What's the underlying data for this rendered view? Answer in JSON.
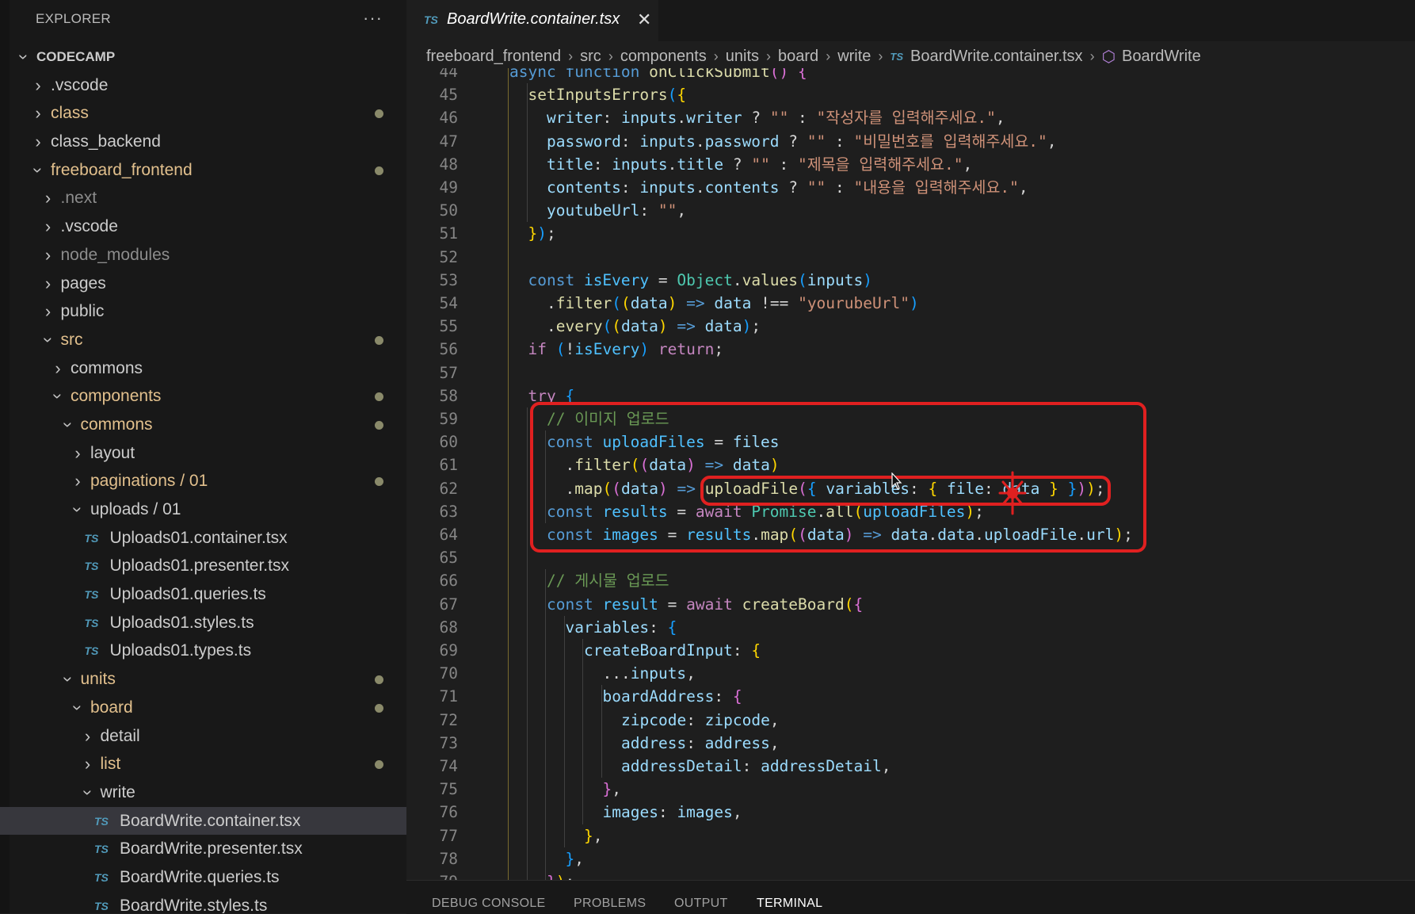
{
  "explorer": {
    "header": "EXPLORER",
    "more": "···",
    "tree": [
      {
        "depth": 0,
        "kind": "folder",
        "open": true,
        "name": "CODECAMP",
        "root": true,
        "color": "#cccccc"
      },
      {
        "depth": 1,
        "kind": "folder",
        "open": false,
        "name": ".vscode",
        "color": "#cccccc"
      },
      {
        "depth": 1,
        "kind": "folder",
        "open": false,
        "name": "class",
        "color": "#e2c08d",
        "modified": true
      },
      {
        "depth": 1,
        "kind": "folder",
        "open": false,
        "name": "class_backend",
        "color": "#cccccc"
      },
      {
        "depth": 1,
        "kind": "folder",
        "open": true,
        "name": "freeboard_frontend",
        "color": "#e2c08d",
        "modified": true
      },
      {
        "depth": 2,
        "kind": "folder",
        "open": false,
        "name": ".next",
        "color": "#8c8c8c"
      },
      {
        "depth": 2,
        "kind": "folder",
        "open": false,
        "name": ".vscode",
        "color": "#cccccc"
      },
      {
        "depth": 2,
        "kind": "folder",
        "open": false,
        "name": "node_modules",
        "color": "#8c8c8c"
      },
      {
        "depth": 2,
        "kind": "folder",
        "open": false,
        "name": "pages",
        "color": "#cccccc"
      },
      {
        "depth": 2,
        "kind": "folder",
        "open": false,
        "name": "public",
        "color": "#cccccc"
      },
      {
        "depth": 2,
        "kind": "folder",
        "open": true,
        "name": "src",
        "color": "#e2c08d",
        "modified": true
      },
      {
        "depth": 3,
        "kind": "folder",
        "open": false,
        "name": "commons",
        "color": "#cccccc"
      },
      {
        "depth": 3,
        "kind": "folder",
        "open": true,
        "name": "components",
        "color": "#e2c08d",
        "modified": true
      },
      {
        "depth": 4,
        "kind": "folder",
        "open": true,
        "name": "commons",
        "color": "#e2c08d",
        "modified": true
      },
      {
        "depth": 5,
        "kind": "folder",
        "open": false,
        "name": "layout",
        "color": "#cccccc"
      },
      {
        "depth": 5,
        "kind": "folder",
        "open": false,
        "name": "paginations / 01",
        "color": "#e2c08d",
        "modified": true
      },
      {
        "depth": 5,
        "kind": "folder",
        "open": true,
        "name": "uploads / 01",
        "color": "#cccccc"
      },
      {
        "depth": 6,
        "kind": "file",
        "name": "Uploads01.container.tsx",
        "color": "#cccccc"
      },
      {
        "depth": 6,
        "kind": "file",
        "name": "Uploads01.presenter.tsx",
        "color": "#cccccc"
      },
      {
        "depth": 6,
        "kind": "file",
        "name": "Uploads01.queries.ts",
        "color": "#cccccc"
      },
      {
        "depth": 6,
        "kind": "file",
        "name": "Uploads01.styles.ts",
        "color": "#cccccc"
      },
      {
        "depth": 6,
        "kind": "file",
        "name": "Uploads01.types.ts",
        "color": "#cccccc"
      },
      {
        "depth": 4,
        "kind": "folder",
        "open": true,
        "name": "units",
        "color": "#e2c08d",
        "modified": true
      },
      {
        "depth": 5,
        "kind": "folder",
        "open": true,
        "name": "board",
        "color": "#e2c08d",
        "modified": true
      },
      {
        "depth": 6,
        "kind": "folder",
        "open": false,
        "name": "detail",
        "color": "#cccccc"
      },
      {
        "depth": 6,
        "kind": "folder",
        "open": false,
        "name": "list",
        "color": "#e2c08d",
        "modified": true
      },
      {
        "depth": 6,
        "kind": "folder",
        "open": true,
        "name": "write",
        "color": "#cccccc"
      },
      {
        "depth": 7,
        "kind": "file",
        "name": "BoardWrite.container.tsx",
        "color": "#cccccc",
        "selected": true
      },
      {
        "depth": 7,
        "kind": "file",
        "name": "BoardWrite.presenter.tsx",
        "color": "#cccccc"
      },
      {
        "depth": 7,
        "kind": "file",
        "name": "BoardWrite.queries.ts",
        "color": "#cccccc"
      },
      {
        "depth": 7,
        "kind": "file",
        "name": "BoardWrite.styles.ts",
        "color": "#cccccc"
      }
    ]
  },
  "tab": {
    "icon": "TS",
    "title": "BoardWrite.container.tsx",
    "close": "✕"
  },
  "breadcrumb": {
    "parts": [
      "freeboard_frontend",
      "src",
      "components",
      "units",
      "board",
      "write"
    ],
    "file_icon": "TS",
    "file": "BoardWrite.container.tsx",
    "symbol_icon": "⬡",
    "symbol": "BoardWrite"
  },
  "editor": {
    "lines": [
      {
        "n": "44",
        "indent": 1,
        "html": "<span class=\"kw\">async</span> <span class=\"kw\">function</span> <span class=\"fn\">onClickSubmit</span><span class=\"p2\">()</span> <span class=\"p2\">{</span>"
      },
      {
        "n": "45",
        "indent": 2,
        "html": "<span class=\"fn\">setInputsErrors</span><span class=\"p3\">(</span><span class=\"p1\">{</span>"
      },
      {
        "n": "46",
        "indent": 3,
        "html": "<span class=\"prop\">writer</span>: <span class=\"prop\">inputs</span>.<span class=\"prop\">writer</span> ? <span class=\"str\">\"\"</span> : <span class=\"str\">\"작성자를 입력해주세요.\"</span>,"
      },
      {
        "n": "47",
        "indent": 3,
        "html": "<span class=\"prop\">password</span>: <span class=\"prop\">inputs</span>.<span class=\"prop\">password</span> ? <span class=\"str\">\"\"</span> : <span class=\"str\">\"비밀번호를 입력해주세요.\"</span>,"
      },
      {
        "n": "48",
        "indent": 3,
        "html": "<span class=\"prop\">title</span>: <span class=\"prop\">inputs</span>.<span class=\"prop\">title</span> ? <span class=\"str\">\"\"</span> : <span class=\"str\">\"제목을 입력해주세요.\"</span>,"
      },
      {
        "n": "49",
        "indent": 3,
        "html": "<span class=\"prop\">contents</span>: <span class=\"prop\">inputs</span>.<span class=\"prop\">contents</span> ? <span class=\"str\">\"\"</span> : <span class=\"str\">\"내용을 입력해주세요.\"</span>,"
      },
      {
        "n": "50",
        "indent": 3,
        "html": "<span class=\"prop\">youtubeUrl</span>: <span class=\"str\">\"\"</span>,"
      },
      {
        "n": "51",
        "indent": 2,
        "html": "<span class=\"p1\">}</span><span class=\"p3\">)</span>;"
      },
      {
        "n": "52",
        "indent": 0,
        "html": ""
      },
      {
        "n": "53",
        "indent": 2,
        "html": "<span class=\"kw\">const</span> <span class=\"cn\">isEvery</span> = <span class=\"cls\">Object</span>.<span class=\"fn\">values</span><span class=\"p3\">(</span><span class=\"prop\">inputs</span><span class=\"p3\">)</span>"
      },
      {
        "n": "54",
        "indent": 3,
        "html": ".<span class=\"fn\">filter</span><span class=\"p3\">(</span><span class=\"p1\">(</span><span class=\"prop\">data</span><span class=\"p1\">)</span> <span class=\"kw\">=&gt;</span> <span class=\"prop\">data</span> !== <span class=\"str\">\"yourubeUrl\"</span><span class=\"p3\">)</span>"
      },
      {
        "n": "55",
        "indent": 3,
        "html": ".<span class=\"fn\">every</span><span class=\"p3\">(</span><span class=\"p1\">(</span><span class=\"prop\">data</span><span class=\"p1\">)</span> <span class=\"kw\">=&gt;</span> <span class=\"prop\">data</span><span class=\"p3\">)</span>;"
      },
      {
        "n": "56",
        "indent": 2,
        "html": "<span class=\"ctl\">if</span> <span class=\"p3\">(</span>!<span class=\"cn\">isEvery</span><span class=\"p3\">)</span> <span class=\"ctl\">return</span>;"
      },
      {
        "n": "57",
        "indent": 0,
        "html": ""
      },
      {
        "n": "58",
        "indent": 2,
        "html": "<span class=\"ctl\">try</span> <span class=\"p3\">{</span>"
      },
      {
        "n": "59",
        "indent": 3,
        "html": "<span class=\"cm\">// 이미지 업로드</span>"
      },
      {
        "n": "60",
        "indent": 3,
        "html": "<span class=\"kw\">const</span> <span class=\"cn\">uploadFiles</span> = <span class=\"prop\">files</span>"
      },
      {
        "n": "61",
        "indent": 4,
        "html": ".<span class=\"fn\">filter</span><span class=\"p1\">(</span><span class=\"p2\">(</span><span class=\"prop\">data</span><span class=\"p2\">)</span> <span class=\"kw\">=&gt;</span> <span class=\"prop\">data</span><span class=\"p1\">)</span>"
      },
      {
        "n": "62",
        "indent": 4,
        "html": ".<span class=\"fn\">map</span><span class=\"p1\">(</span><span class=\"p2\">(</span><span class=\"prop\">data</span><span class=\"p2\">)</span> <span class=\"kw\">=&gt;</span> <span class=\"fn\">uploadFile</span><span class=\"p2\">(</span><span class=\"p3\">{</span> <span class=\"prop\">variables</span>: <span class=\"p1\">{</span> <span class=\"prop\">file</span>: <span class=\"prop\">data</span> <span class=\"p1\">}</span> <span class=\"p3\">}</span><span class=\"p2\">)</span><span class=\"p1\">)</span>;"
      },
      {
        "n": "63",
        "indent": 3,
        "html": "<span class=\"kw\">const</span> <span class=\"cn\">results</span> = <span class=\"ctl\">await</span> <span class=\"cls\">Promise</span>.<span class=\"fn\">all</span><span class=\"p1\">(</span><span class=\"cn\">uploadFiles</span><span class=\"p1\">)</span>;"
      },
      {
        "n": "64",
        "indent": 3,
        "html": "<span class=\"kw\">const</span> <span class=\"cn\">images</span> = <span class=\"cn\">results</span>.<span class=\"fn\">map</span><span class=\"p1\">(</span><span class=\"p2\">(</span><span class=\"prop\">data</span><span class=\"p2\">)</span> <span class=\"kw\">=&gt;</span> <span class=\"prop\">data</span>.<span class=\"prop\">data</span>.<span class=\"prop\">uploadFile</span>.<span class=\"prop\">url</span><span class=\"p1\">)</span>;"
      },
      {
        "n": "65",
        "indent": 0,
        "html": ""
      },
      {
        "n": "66",
        "indent": 3,
        "html": "<span class=\"cm\">// 게시물 업로드</span>"
      },
      {
        "n": "67",
        "indent": 3,
        "html": "<span class=\"kw\">const</span> <span class=\"cn\">result</span> = <span class=\"ctl\">await</span> <span class=\"fn\">createBoard</span><span class=\"p1\">(</span><span class=\"p2\">{</span>"
      },
      {
        "n": "68",
        "indent": 4,
        "html": "<span class=\"prop\">variables</span>: <span class=\"p3\">{</span>"
      },
      {
        "n": "69",
        "indent": 5,
        "html": "<span class=\"prop\">createBoardInput</span>: <span class=\"p1\">{</span>"
      },
      {
        "n": "70",
        "indent": 6,
        "html": "...<span class=\"prop\">inputs</span>,"
      },
      {
        "n": "71",
        "indent": 6,
        "html": "<span class=\"prop\">boardAddress</span>: <span class=\"p2\">{</span>"
      },
      {
        "n": "72",
        "indent": 7,
        "html": "<span class=\"prop\">zipcode</span>: <span class=\"prop\">zipcode</span>,"
      },
      {
        "n": "73",
        "indent": 7,
        "html": "<span class=\"prop\">address</span>: <span class=\"prop\">address</span>,"
      },
      {
        "n": "74",
        "indent": 7,
        "html": "<span class=\"prop\">addressDetail</span>: <span class=\"prop\">addressDetail</span>,"
      },
      {
        "n": "75",
        "indent": 6,
        "html": "<span class=\"p2\">}</span>,"
      },
      {
        "n": "76",
        "indent": 6,
        "html": "<span class=\"prop\">images</span>: <span class=\"prop\">images</span>,"
      },
      {
        "n": "77",
        "indent": 5,
        "html": "<span class=\"p1\">}</span>,"
      },
      {
        "n": "78",
        "indent": 4,
        "html": "<span class=\"p3\">}</span>,"
      },
      {
        "n": "79",
        "indent": 3,
        "html": "<span class=\"p2\">}</span><span class=\"p1\">)</span>;"
      }
    ]
  },
  "panel": {
    "tabs": [
      "DEBUG CONSOLE",
      "PROBLEMS",
      "OUTPUT",
      "TERMINAL"
    ],
    "active": "TERMINAL"
  },
  "colors": {
    "accent_highlight": "#e02020",
    "ts_icon": "#519aba",
    "modified": "#e2c08d"
  }
}
